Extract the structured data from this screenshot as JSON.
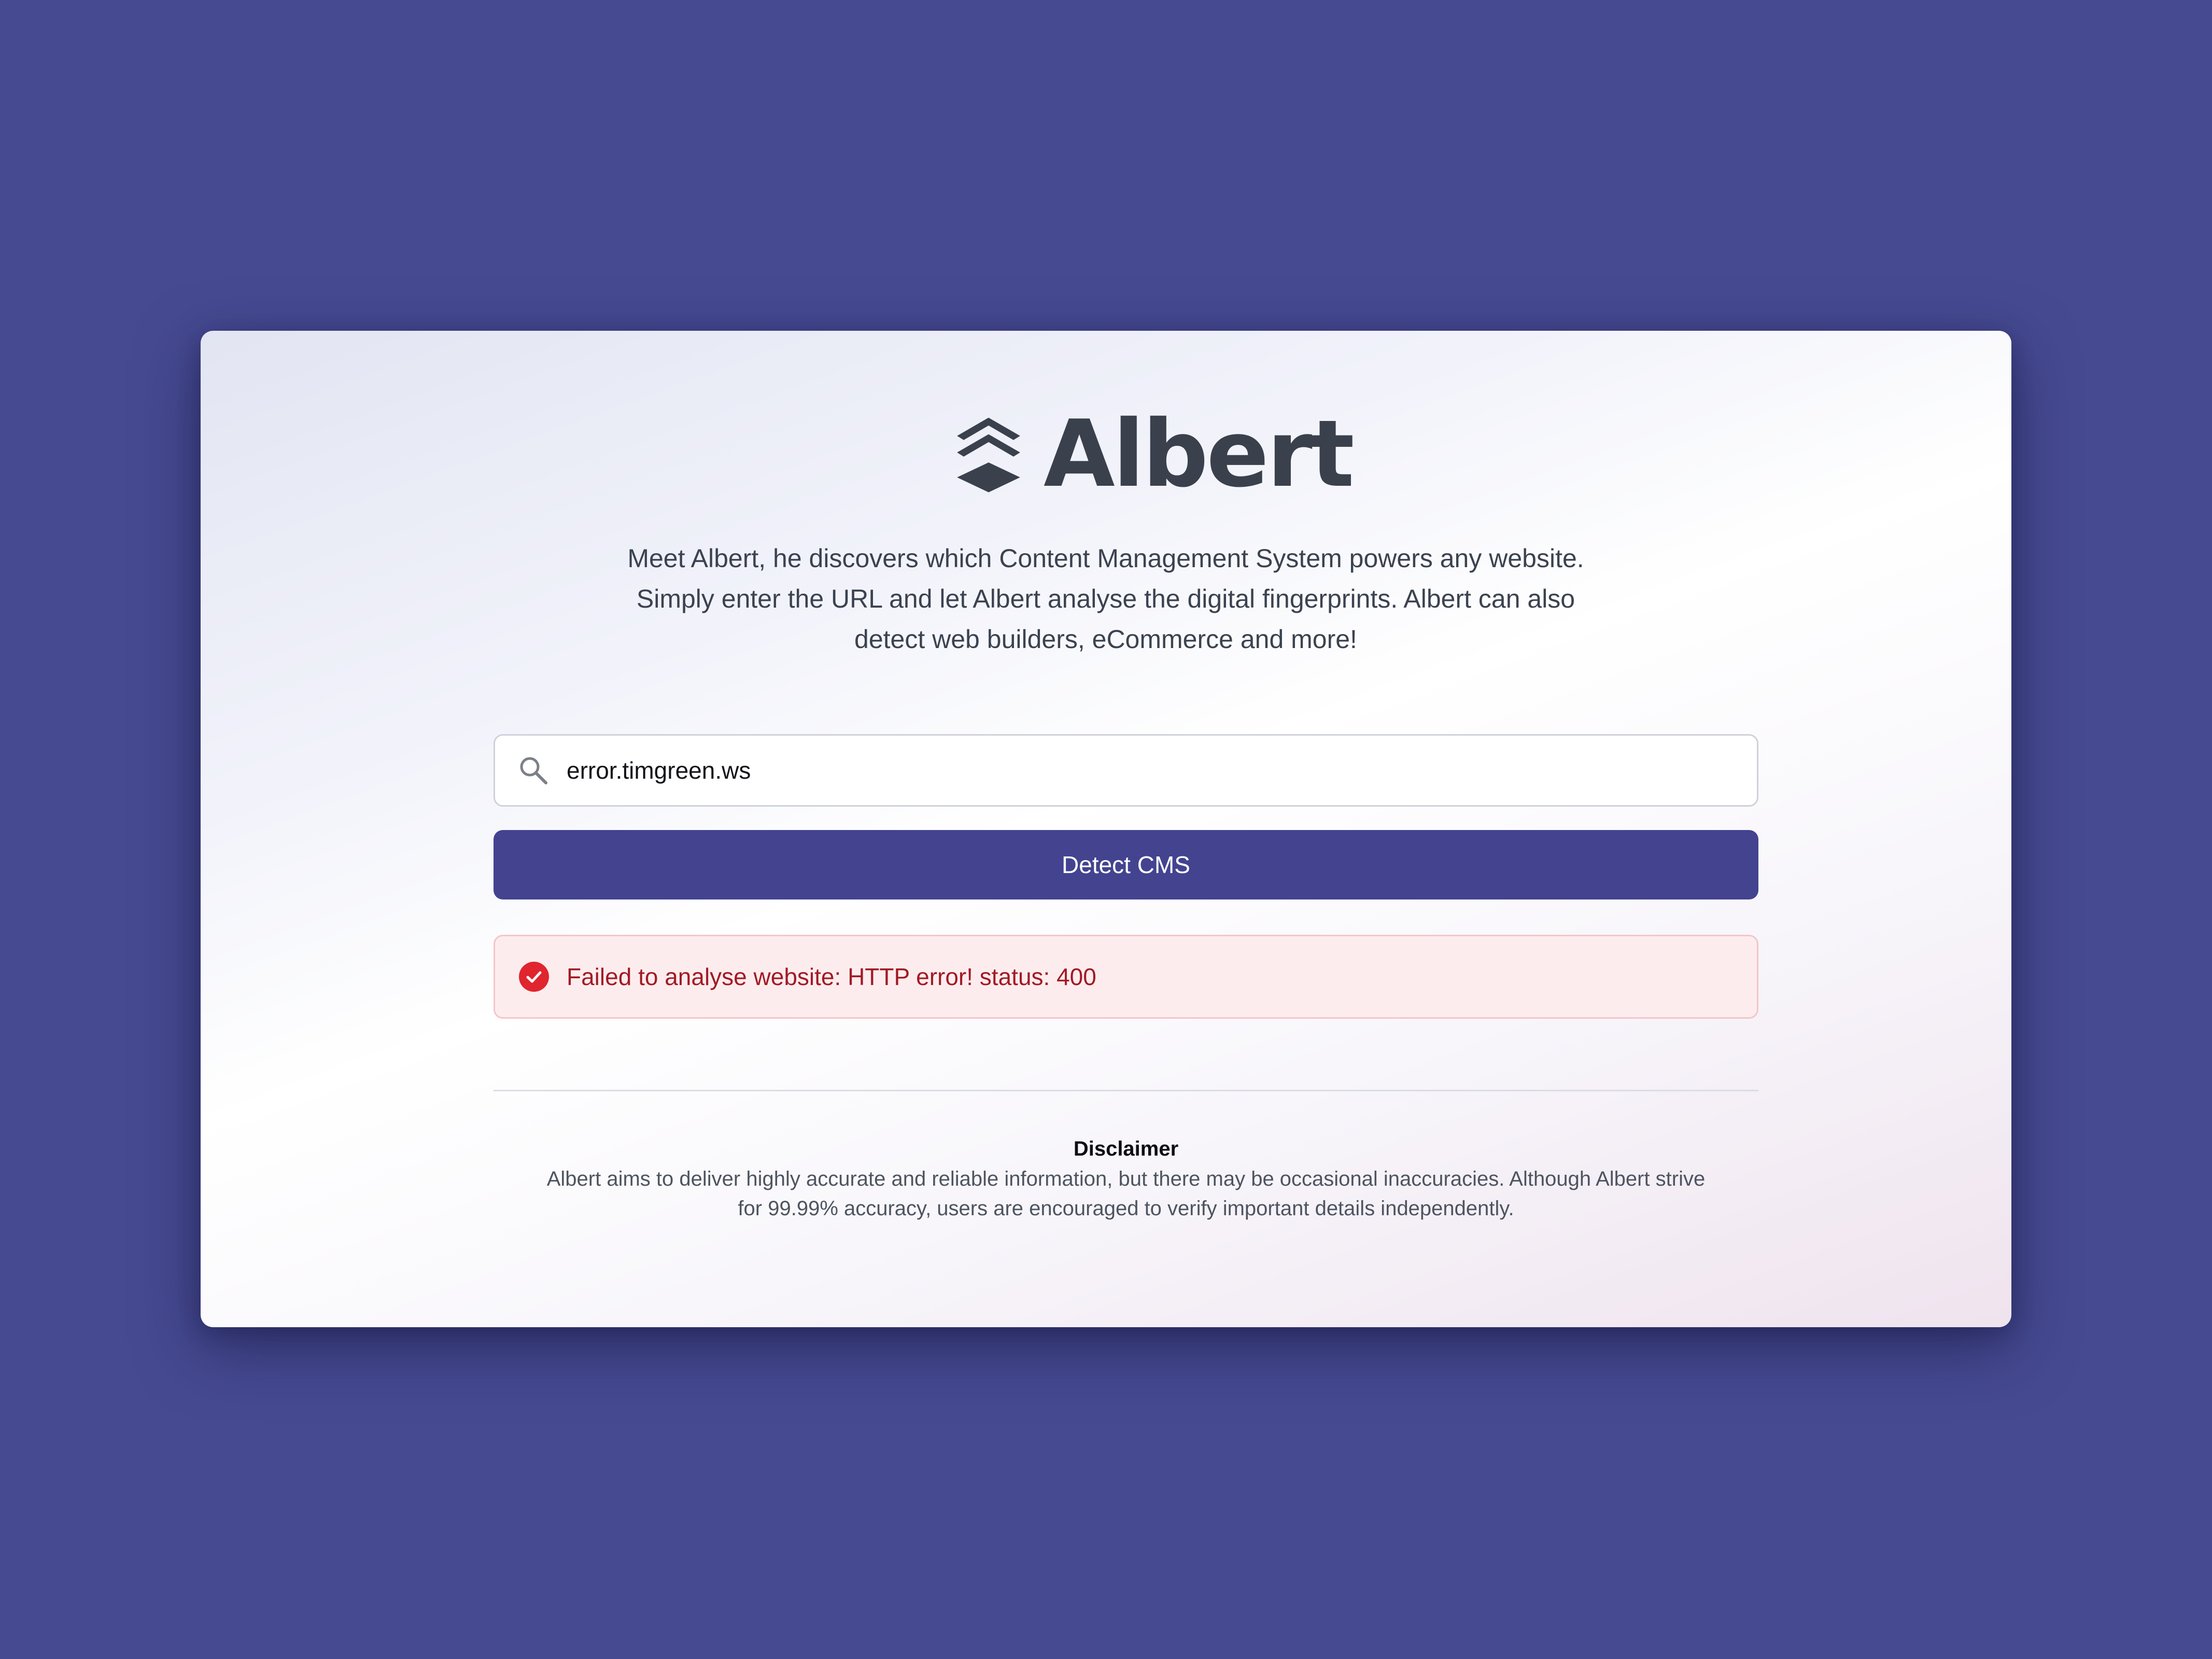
{
  "brand": {
    "name": "Albert",
    "logo_icon": "stacked-chevron-icon",
    "color": "#3a414c"
  },
  "intro": {
    "line1": "Meet Albert, he discovers which Content Management System powers any website.",
    "line2": "Simply enter the URL and let Albert analyse the digital fingerprints. Albert can also",
    "line3": "detect web builders, eCommerce and more!"
  },
  "search": {
    "icon": "search-icon",
    "value": "error.timgreen.ws"
  },
  "detect_button": {
    "label": "Detect CMS",
    "color": "#434390"
  },
  "alert": {
    "icon": "check-circle-icon",
    "message": "Failed to analyse website: HTTP error! status: 400",
    "text_color": "#a11a24",
    "background": "#fdecee"
  },
  "disclaimer": {
    "title": "Disclaimer",
    "line1": "Albert aims to deliver highly accurate and reliable information, but there may be occasional inaccuracies. Although Albert strive",
    "line2": "for 99.99% accuracy, users are encouraged to verify important details independently."
  },
  "colors": {
    "page_background": "#464a91",
    "card_background": "#ffffff"
  }
}
